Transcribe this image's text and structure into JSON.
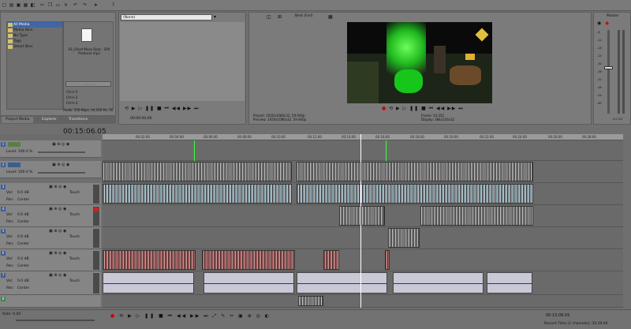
{
  "explorer": {
    "tree": [
      "All Media",
      "Media Bins",
      "No Type",
      "Tags",
      "Smart Bins"
    ],
    "media_file": "03_Ghost Muse Dark - SPX Producer.mp3",
    "search_placeholder": "Enter text to add tags",
    "tag_lines": [
      "Ctrl+1",
      "Ctrl+2",
      "Ctrl+3"
    ],
    "audio_info": "Audio: 256 Kbps, 44,100 Hz, 16"
  },
  "tabs": [
    "Project Media",
    "Explorer",
    "Transitions"
  ],
  "trimmer": {
    "dropdown": "(None)",
    "timecode": "00:00:00;00"
  },
  "preview": {
    "quality": "Best (Full)",
    "project_label": "Project:",
    "project_value": "1920x1080x32, 59.940p",
    "preview_label": "Preview:",
    "preview_value": "1920x1080x32, 59.940p",
    "frame_label": "Frame:",
    "frame_value": "54,352",
    "display_label": "Display:",
    "display_value": "384x216x32"
  },
  "master": {
    "title": "Master",
    "scale": [
      "-6",
      "-12",
      "-18",
      "-24",
      "-30",
      "-36",
      "-42",
      "-48",
      "-54",
      "-60"
    ],
    "bottom": [
      "0.0",
      "0.0"
    ]
  },
  "timeline": {
    "timecode": "00:15:06.05",
    "ruler": [
      "00:02:00",
      "00:04:00",
      "00:06:00",
      "00:08:00",
      "00:10:00",
      "00:12:00",
      "00:14:00",
      "00:16:00",
      "00:18:00",
      "00:20:00",
      "00:22:00",
      "00:24:00",
      "00:26:00",
      "00:28:00"
    ],
    "video_tracks": [
      {
        "num": "1",
        "level": "Level: 100.0 %"
      },
      {
        "num": "2",
        "level": "Level: 100.0 %"
      }
    ],
    "audio_tracks": [
      {
        "num": "3",
        "vol": "Vol:",
        "vol_val": "0.0 dB",
        "pan": "Pan:",
        "pan_val": "Center",
        "touch": "Touch"
      },
      {
        "num": "4",
        "vol": "Vol:",
        "vol_val": "0.0 dB",
        "pan": "Pan:",
        "pan_val": "Center",
        "touch": "Touch"
      },
      {
        "num": "5",
        "vol": "Vol:",
        "vol_val": "0.0 dB",
        "pan": "Pan:",
        "pan_val": "Center",
        "touch": "Touch"
      },
      {
        "num": "6",
        "vol": "Vol:",
        "vol_val": "0.0 dB",
        "pan": "Pan:",
        "pan_val": "Center",
        "touch": "Touch"
      },
      {
        "num": "7",
        "vol": "Vol:",
        "vol_val": "0.0 dB",
        "pan": "Pan:",
        "pan_val": "Center",
        "touch": "Touch"
      }
    ],
    "rate": "Rate: 0.00"
  },
  "status": {
    "time": "00:15:06.05",
    "record_time": "Record Time (2 channels): 33:19:40"
  }
}
